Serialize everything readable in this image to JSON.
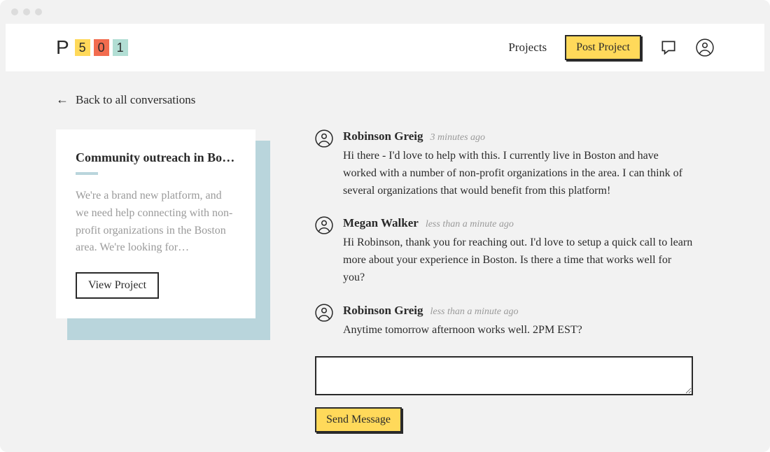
{
  "nav": {
    "projects_label": "Projects",
    "post_project_label": "Post Project"
  },
  "back_link": "Back to all conversations",
  "project_card": {
    "title": "Community outreach in Bosto…",
    "description": "We're a brand new platform, and we need help connecting with non-profit organizations in the Boston area. We're looking for…",
    "view_label": "View Project"
  },
  "messages": [
    {
      "author": "Robinson Greig",
      "time": "3 minutes ago",
      "text": "Hi there - I'd love to help with this. I currently live in Boston and have worked with a number of non-profit organizations in the area. I can think of several organizations that would benefit from this platform!"
    },
    {
      "author": "Megan Walker",
      "time": "less than a minute ago",
      "text": "Hi Robinson, thank you for reaching out. I'd love to setup a quick call to learn more about your experience in Boston. Is there a time that works well for you?"
    },
    {
      "author": "Robinson Greig",
      "time": "less than a minute ago",
      "text": "Anytime tomorrow afternoon works well. 2PM EST?"
    }
  ],
  "send_label": "Send Message"
}
